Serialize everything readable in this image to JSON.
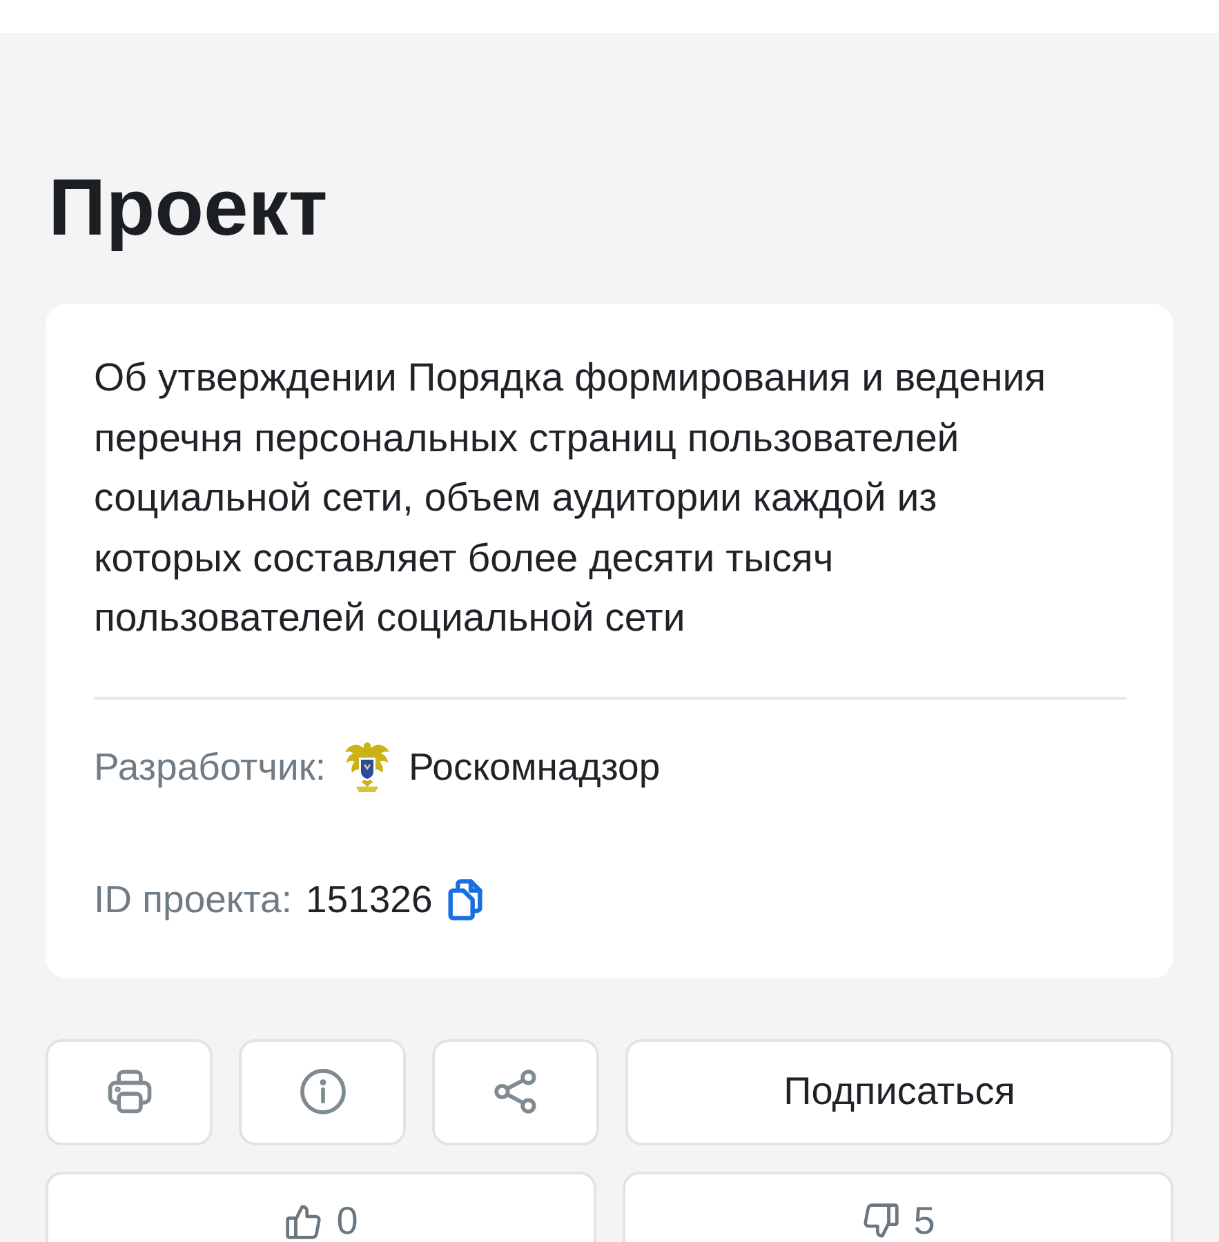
{
  "page": {
    "title": "Проект"
  },
  "project_card": {
    "description": "Об утверждении Порядка формирования и ведения перечня персональных страниц пользователей социальной сети, объем аудитории каждой из которых составляет более десяти тысяч пользователей социальной сети",
    "developer": {
      "label": "Разработчик:",
      "name": "Роскомнадзор"
    },
    "project_id": {
      "label": "ID проекта:",
      "value": "151326"
    }
  },
  "actions": {
    "subscribe_button": "Подписаться",
    "likes": "0",
    "dislikes": "5"
  }
}
